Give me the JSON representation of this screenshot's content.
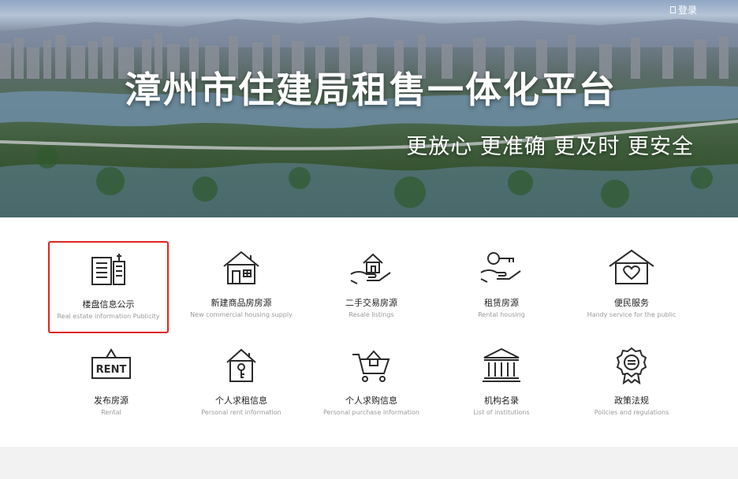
{
  "header": {
    "login_label": "登录",
    "title": "漳州市住建局租售一体化平台",
    "slogan": "更放心  更准确  更及时  更安全"
  },
  "services": [
    {
      "cn": "楼盘信息公示",
      "en": "Real estate information Publicity",
      "icon": "building-list-icon",
      "selected": true
    },
    {
      "cn": "新建商品房房源",
      "en": "New commercial housing supply",
      "icon": "house-icon"
    },
    {
      "cn": "二手交易房源",
      "en": "Resale listings",
      "icon": "hand-house-icon"
    },
    {
      "cn": "租赁房源",
      "en": "Rental housing",
      "icon": "hand-key-icon"
    },
    {
      "cn": "便民服务",
      "en": "Handy service for the public",
      "icon": "heart-house-icon"
    },
    {
      "cn": "发布房源",
      "en": "Rental",
      "icon": "rent-sign-icon"
    },
    {
      "cn": "个人求租信息",
      "en": "Personal rent information",
      "icon": "house-key-icon"
    },
    {
      "cn": "个人求购信息",
      "en": "Personal purchase information",
      "icon": "cart-house-icon"
    },
    {
      "cn": "机构名录",
      "en": "List of institutions",
      "icon": "institution-icon"
    },
    {
      "cn": "政策法规",
      "en": "Policies and regulations",
      "icon": "policy-badge-icon"
    }
  ],
  "rent_sign_text": "RENT",
  "colors": {
    "selected_border": "#e0251b",
    "icon_stroke": "#2b2b2b",
    "footer_band": "#f2f2f2"
  }
}
